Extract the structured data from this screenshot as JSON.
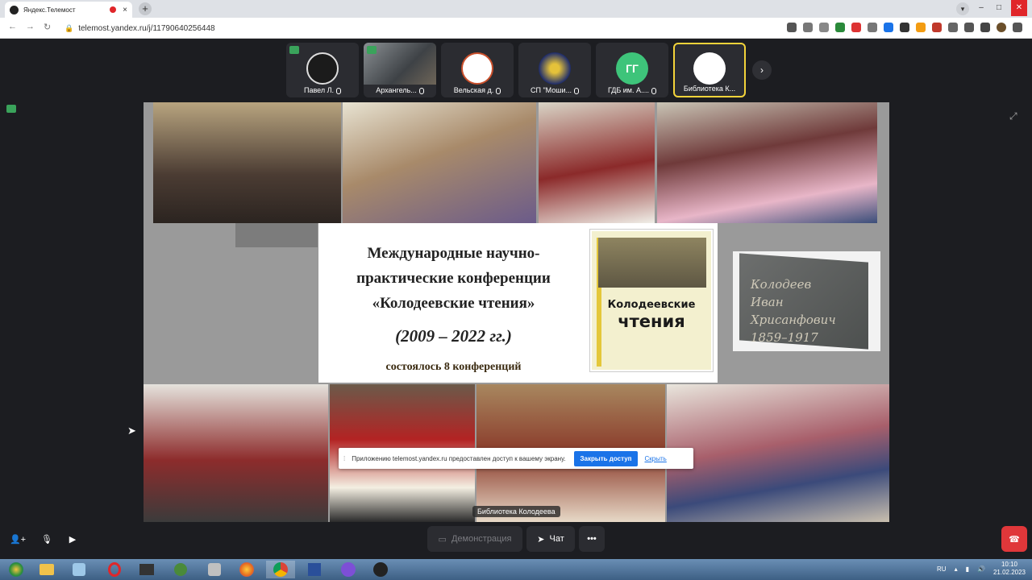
{
  "browser": {
    "tab_title": "Яндекс.Телемост",
    "tab_close": "×",
    "new_tab": "+",
    "url": "telemost.yandex.ru/j/11790640256448",
    "back": "←",
    "forward": "→",
    "reload": "↻",
    "window": {
      "minimize": "–",
      "maximize": "□",
      "close": "✕"
    }
  },
  "participants": [
    {
      "name": "Павел Л.",
      "avatar_color": "#1b1b1b"
    },
    {
      "name": "Архангель...",
      "avatar_color": "#6b6b6b"
    },
    {
      "name": "Вельская д.",
      "avatar_color": "#ffffff"
    },
    {
      "name": "СП \"Моши...",
      "avatar_color": "#1d2b6b"
    },
    {
      "name": "ГДБ им. А....",
      "initials": "ГГ",
      "avatar_color": "#3ec47a"
    },
    {
      "name": "Библиотека К...",
      "avatar_color": "#ffffff",
      "active": true
    }
  ],
  "next_button": "›",
  "slide": {
    "title": "Международные научно-практические конференции «Колодеевские чтения»",
    "title_lines": [
      "Международные научно-",
      "практические конференции",
      "«Колодеевские чтения»"
    ],
    "years": "(2009 – 2022 гг.)",
    "count": "состоялось 8 конференций",
    "book_title_1": "Колодеевские",
    "book_title_2": "чтения",
    "plaque_script": [
      "Колодеев",
      "Иван",
      "Хрисанфович",
      "1859–1917"
    ]
  },
  "notification": {
    "text": "Приложению telemost.yandex.ru предоставлен доступ к вашему экрану.",
    "stop_button": "Закрыть доступ",
    "hide_link": "Скрыть"
  },
  "speaker_caption": "Библиотека Колодеева",
  "controls": {
    "demo_label": "Демонстрация",
    "chat_label": "Чат",
    "more_label": "•••"
  },
  "taskbar": {
    "lang": "RU",
    "time": "10:10",
    "date": "21.02.2023"
  },
  "colors": {
    "accent_yellow": "#f3d33a",
    "hangup_red": "#e0373a",
    "share_blue": "#1a73e8"
  }
}
